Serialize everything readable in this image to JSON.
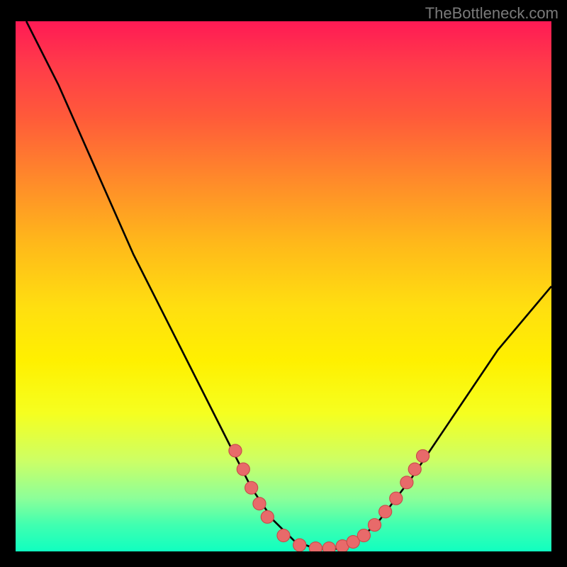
{
  "watermark": "TheBottleneck.com",
  "chart_data": {
    "type": "line",
    "title": "",
    "xlabel": "",
    "ylabel": "",
    "xlim": [
      0,
      100
    ],
    "ylim": [
      0,
      100
    ],
    "curve": [
      {
        "x": 2,
        "y": 100
      },
      {
        "x": 8,
        "y": 88
      },
      {
        "x": 15,
        "y": 72
      },
      {
        "x": 22,
        "y": 56
      },
      {
        "x": 30,
        "y": 40
      },
      {
        "x": 38,
        "y": 24
      },
      {
        "x": 44,
        "y": 12
      },
      {
        "x": 48,
        "y": 6
      },
      {
        "x": 52,
        "y": 2
      },
      {
        "x": 56,
        "y": 0.5
      },
      {
        "x": 60,
        "y": 0.5
      },
      {
        "x": 64,
        "y": 2
      },
      {
        "x": 68,
        "y": 6
      },
      {
        "x": 74,
        "y": 14
      },
      {
        "x": 82,
        "y": 26
      },
      {
        "x": 90,
        "y": 38
      },
      {
        "x": 100,
        "y": 50
      }
    ],
    "marker_series": [
      {
        "x": 41,
        "y": 19
      },
      {
        "x": 42.5,
        "y": 15.5
      },
      {
        "x": 44,
        "y": 12
      },
      {
        "x": 45.5,
        "y": 9
      },
      {
        "x": 47,
        "y": 6.5
      },
      {
        "x": 50,
        "y": 3
      },
      {
        "x": 53,
        "y": 1.2
      },
      {
        "x": 56,
        "y": 0.6
      },
      {
        "x": 58.5,
        "y": 0.6
      },
      {
        "x": 61,
        "y": 1
      },
      {
        "x": 63,
        "y": 1.8
      },
      {
        "x": 65,
        "y": 3
      },
      {
        "x": 67,
        "y": 5
      },
      {
        "x": 69,
        "y": 7.5
      },
      {
        "x": 71,
        "y": 10
      },
      {
        "x": 73,
        "y": 13
      },
      {
        "x": 74.5,
        "y": 15.5
      },
      {
        "x": 76,
        "y": 18
      }
    ],
    "colors": {
      "curve": "#000000",
      "marker_fill": "#e86a6a",
      "marker_stroke": "#c94a4a"
    }
  }
}
